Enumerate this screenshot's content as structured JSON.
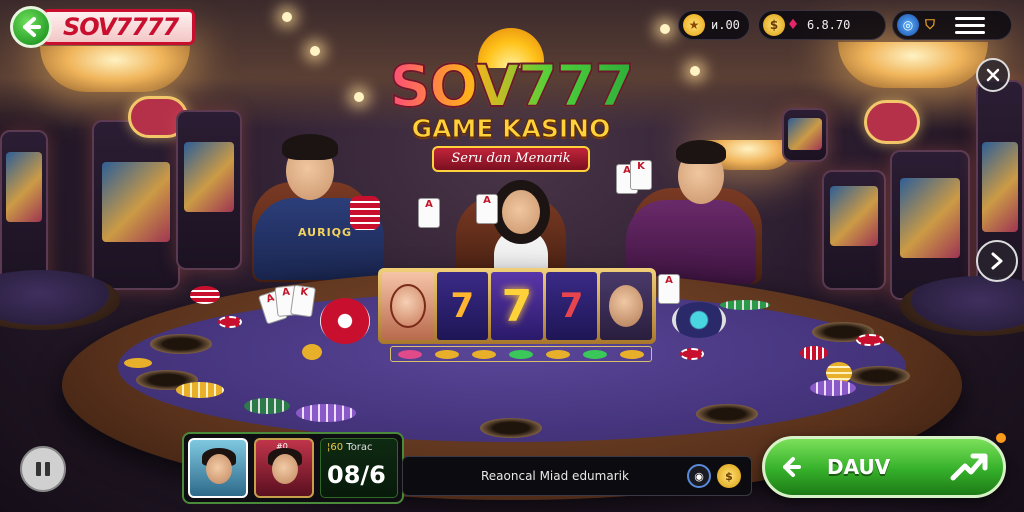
{
  "brand": {
    "name": "SOV7777"
  },
  "logo": {
    "title": "SOV777",
    "subtitle": "GAME KASINO",
    "tagline": "Seru dan Menarik"
  },
  "topbar": {
    "stars_value": "и.00",
    "coins_value": "6.8.70"
  },
  "players": {
    "left_shirt": "AURIQG"
  },
  "reels": {
    "symbols": [
      "",
      "7",
      "7",
      "7",
      ""
    ]
  },
  "hud": {
    "avatar_1_tag": "",
    "avatar_2_tag": "#0",
    "score_label_1": "¦60",
    "score_label_2": "Torac",
    "score_value": "08/6",
    "message": "Reaoncal  Miad edumarik",
    "play_label": "DAUV"
  },
  "colors": {
    "accent_green": "#35b02a",
    "brand_red": "#c8102e",
    "felt_purple": "#46357e",
    "gold": "#ffd13a"
  },
  "icons": {
    "back": "arrow-left-icon",
    "star": "star-icon",
    "coin": "coin-icon",
    "gem": "gem-icon",
    "globe": "globe-icon",
    "shield": "shield-icon",
    "menu": "menu-icon",
    "close": "close-icon",
    "next": "chevron-right-icon",
    "pause": "pause-icon",
    "rewind": "rewind-icon",
    "trend": "trend-up-icon"
  }
}
